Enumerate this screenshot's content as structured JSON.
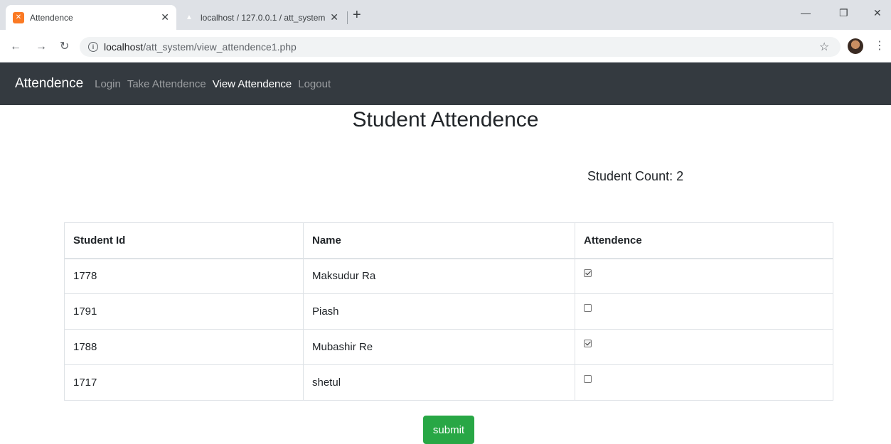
{
  "browser": {
    "tabs": [
      {
        "title": "Attendence",
        "icon": "xampp-icon"
      },
      {
        "title": "localhost / 127.0.0.1 / att_system",
        "icon": "phpmyadmin-icon"
      }
    ],
    "url_host": "localhost",
    "url_path": "/att_system/view_attendence1.php"
  },
  "navbar": {
    "brand": "Attendence",
    "links": [
      "Login",
      "Take Attendence",
      "View Attendence",
      "Logout"
    ],
    "active": "View Attendence"
  },
  "page": {
    "title": "Student Attendence",
    "count": "Student Count: 2"
  },
  "table": {
    "headers": [
      "Student Id",
      "Name",
      "Attendence"
    ],
    "rows": [
      {
        "id": "1778",
        "name": "Maksudur Ra",
        "present": true
      },
      {
        "id": "1791",
        "name": "Piash",
        "present": false
      },
      {
        "id": "1788",
        "name": "Mubashir Re",
        "present": true
      },
      {
        "id": "1717",
        "name": "shetul",
        "present": false
      }
    ]
  },
  "submit_label": "submit",
  "colors": {
    "navbar": "#343a40",
    "submit": "#28a745"
  }
}
